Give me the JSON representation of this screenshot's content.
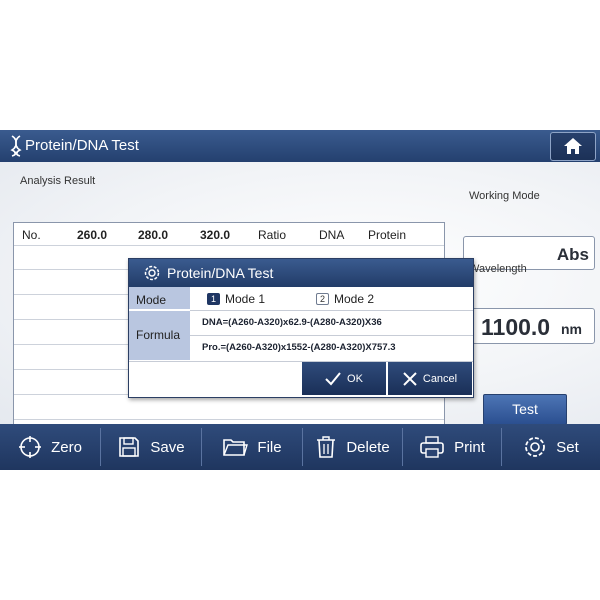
{
  "window": {
    "title": "Protein/DNA Test",
    "home_icon": "home-icon"
  },
  "results": {
    "section_label": "Analysis Result",
    "columns": [
      "No.",
      "260.0",
      "280.0",
      "320.0",
      "Ratio",
      "DNA",
      "Protein"
    ],
    "rows": []
  },
  "working_mode": {
    "label": "Working Mode",
    "value": "Abs"
  },
  "wavelength": {
    "label": "Wavelength",
    "value": "1100.0",
    "unit": "nm"
  },
  "test_button": "Test",
  "toolbar": {
    "items": [
      {
        "label": "Zero",
        "icon": "crosshair-icon"
      },
      {
        "label": "Save",
        "icon": "floppy-disk-icon"
      },
      {
        "label": "File",
        "icon": "folder-icon"
      },
      {
        "label": "Delete",
        "icon": "trash-icon"
      },
      {
        "label": "Print",
        "icon": "printer-icon"
      },
      {
        "label": "Set",
        "icon": "gear-icon"
      }
    ]
  },
  "dialog": {
    "title": "Protein/DNA Test",
    "mode_label": "Mode",
    "mode_options": [
      {
        "badge": "1",
        "label": "Mode 1",
        "selected": true
      },
      {
        "badge": "2",
        "label": "Mode 2",
        "selected": false
      }
    ],
    "formula_label": "Formula",
    "formula_dna": "DNA=(A260-A320)x62.9-(A280-A320)X36",
    "formula_pro": "Pro.=(A260-A320)x1552-(A280-A320)X757.3",
    "ok_label": "OK",
    "cancel_label": "Cancel"
  },
  "colors": {
    "accent": "#2a4675",
    "label_cell": "#b9c6e0",
    "button": "#3b62a3"
  }
}
